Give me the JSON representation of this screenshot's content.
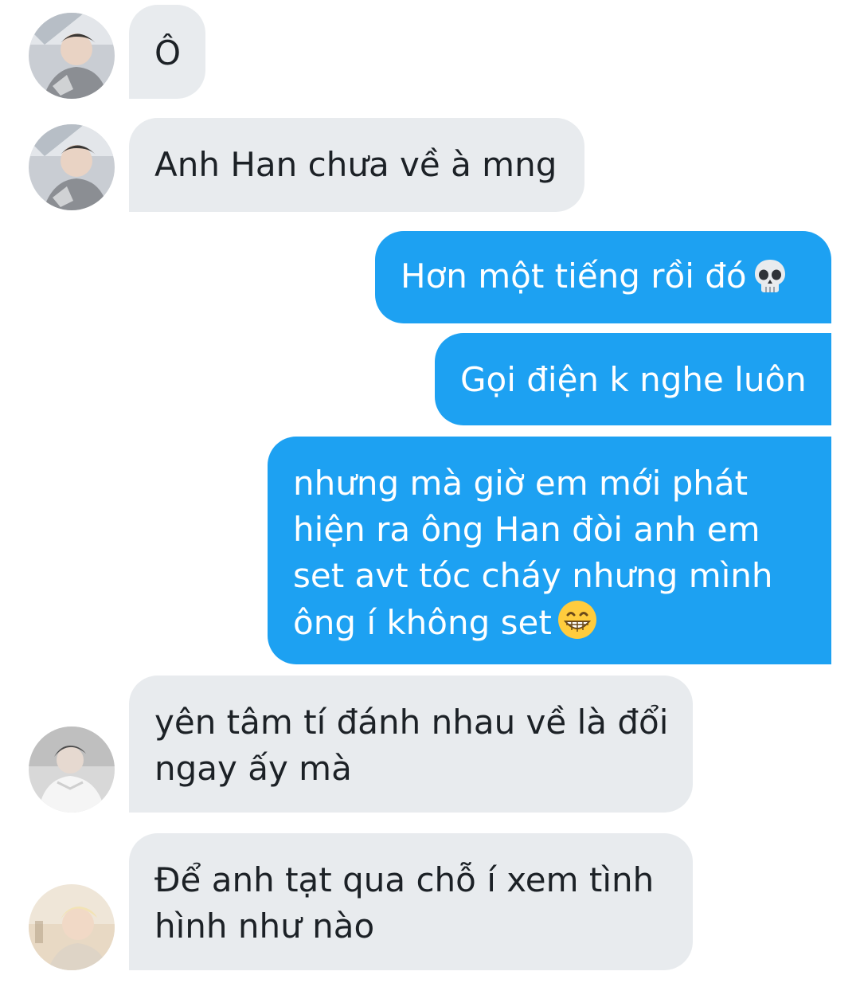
{
  "messages": [
    {
      "direction": "incoming",
      "sender_avatar": "avatar-boy-glasses",
      "lines": [
        "Ô"
      ]
    },
    {
      "direction": "incoming",
      "sender_avatar": "avatar-boy-glasses",
      "lines": [
        "Anh Han chưa về à mng"
      ]
    },
    {
      "direction": "outgoing",
      "lines": [
        "Hơn một tiếng rồi đó"
      ],
      "emoji": "skull-icon"
    },
    {
      "direction": "outgoing",
      "lines": [
        "Gọi điện k nghe luôn"
      ]
    },
    {
      "direction": "outgoing",
      "lines": [
        "nhưng mà giờ em mới phát",
        "hiện ra ông Han đòi anh em",
        "set avt tóc cháy nhưng mình",
        "ông í không set"
      ],
      "emoji": "grinning-face-icon"
    },
    {
      "direction": "incoming",
      "sender_avatar": "avatar-boy-white-hoodie",
      "lines": [
        "yên tâm tí đánh nhau về là đổi",
        "ngay ấy mà"
      ]
    },
    {
      "direction": "incoming",
      "sender_avatar": "avatar-boy-blond",
      "lines": [
        "Để anh tạt qua chỗ í xem tình",
        "hình như nào"
      ]
    }
  ],
  "colors": {
    "incoming_bubble": "#e8ebee",
    "incoming_text": "#1c2126",
    "outgoing_bubble": "#1da1f2",
    "outgoing_text": "#ffffff",
    "background": "#ffffff"
  }
}
